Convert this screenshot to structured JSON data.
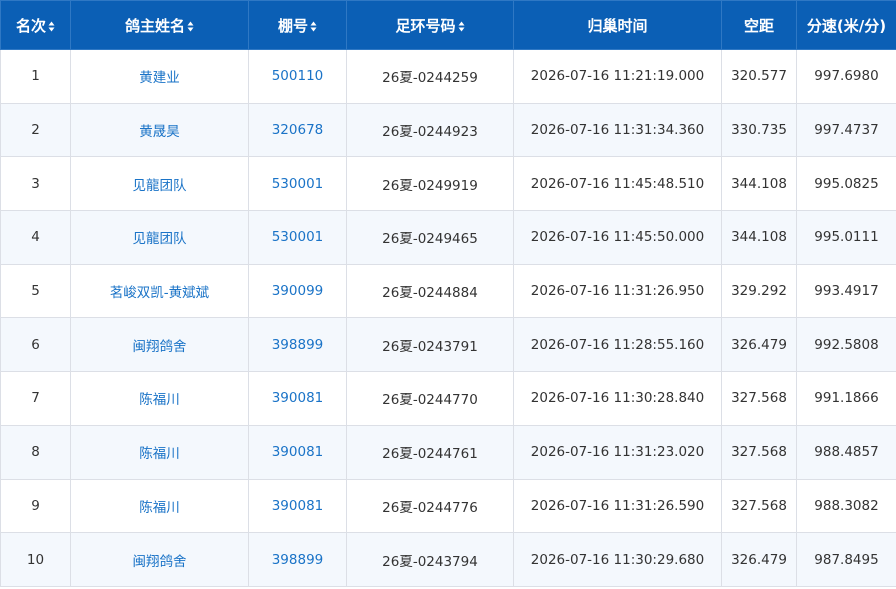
{
  "columns": {
    "rank": "名次",
    "owner": "鸽主姓名",
    "loft": "棚号",
    "ring": "足环号码",
    "time": "归巢时间",
    "distance": "空距",
    "speed": "分速(米/分)"
  },
  "rows": [
    {
      "rank": "1",
      "owner": "黄建业",
      "loft": "500110",
      "ring": "26夏-0244259",
      "time": "2026-07-16 11:21:19.000",
      "distance": "320.577",
      "speed": "997.6980"
    },
    {
      "rank": "2",
      "owner": "黄晟昊",
      "loft": "320678",
      "ring": "26夏-0244923",
      "time": "2026-07-16 11:31:34.360",
      "distance": "330.735",
      "speed": "997.4737"
    },
    {
      "rank": "3",
      "owner": "见龍团队",
      "loft": "530001",
      "ring": "26夏-0249919",
      "time": "2026-07-16 11:45:48.510",
      "distance": "344.108",
      "speed": "995.0825"
    },
    {
      "rank": "4",
      "owner": "见龍团队",
      "loft": "530001",
      "ring": "26夏-0249465",
      "time": "2026-07-16 11:45:50.000",
      "distance": "344.108",
      "speed": "995.0111"
    },
    {
      "rank": "5",
      "owner": "茗峻双凯-黄斌斌",
      "loft": "390099",
      "ring": "26夏-0244884",
      "time": "2026-07-16 11:31:26.950",
      "distance": "329.292",
      "speed": "993.4917"
    },
    {
      "rank": "6",
      "owner": "闽翔鸽舍",
      "loft": "398899",
      "ring": "26夏-0243791",
      "time": "2026-07-16 11:28:55.160",
      "distance": "326.479",
      "speed": "992.5808"
    },
    {
      "rank": "7",
      "owner": "陈福川",
      "loft": "390081",
      "ring": "26夏-0244770",
      "time": "2026-07-16 11:30:28.840",
      "distance": "327.568",
      "speed": "991.1866"
    },
    {
      "rank": "8",
      "owner": "陈福川",
      "loft": "390081",
      "ring": "26夏-0244761",
      "time": "2026-07-16 11:31:23.020",
      "distance": "327.568",
      "speed": "988.4857"
    },
    {
      "rank": "9",
      "owner": "陈福川",
      "loft": "390081",
      "ring": "26夏-0244776",
      "time": "2026-07-16 11:31:26.590",
      "distance": "327.568",
      "speed": "988.3082"
    },
    {
      "rank": "10",
      "owner": "闽翔鸽舍",
      "loft": "398899",
      "ring": "26夏-0243794",
      "time": "2026-07-16 11:30:29.680",
      "distance": "326.479",
      "speed": "987.8495"
    }
  ],
  "colors": {
    "header_bg": "#0b5fb5",
    "link": "#1a73c7",
    "stripe": "#f4f8fd"
  },
  "icons": {
    "sort": "sort-updown-icon"
  }
}
